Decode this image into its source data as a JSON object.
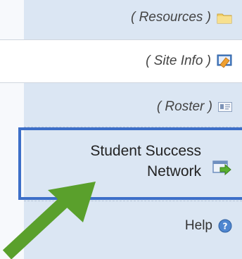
{
  "nav": {
    "resources": "( Resources )",
    "site_info": "( Site Info )",
    "roster": "( Roster )",
    "ssn_line1": "Student Success",
    "ssn_line2": "Network",
    "help": "Help"
  },
  "icons": {
    "resources": "folder-icon",
    "site_info": "site-info-icon",
    "roster": "roster-card-icon",
    "ssn": "external-link-arrow-icon",
    "help": "help-circle-icon",
    "pointer": "green-arrow-icon"
  },
  "colors": {
    "panel_bg": "#dbe6f3",
    "highlight_border": "#3d6fc8",
    "arrow": "#5aa02c"
  }
}
